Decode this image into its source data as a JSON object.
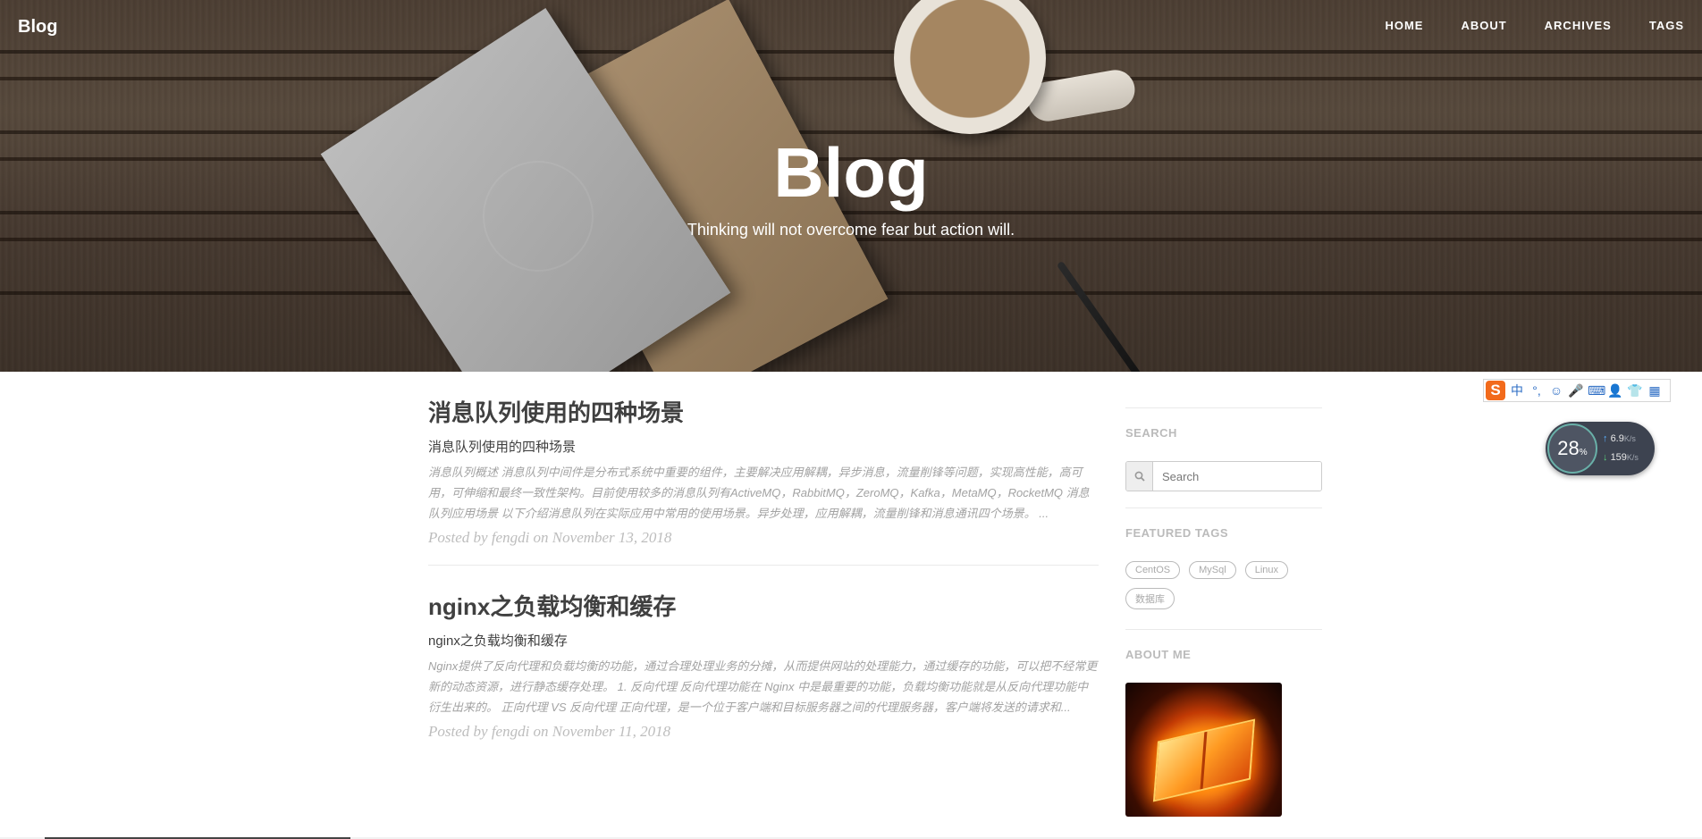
{
  "navbar": {
    "brand": "Blog",
    "links": [
      "HOME",
      "ABOUT",
      "ARCHIVES",
      "TAGS"
    ]
  },
  "hero": {
    "title": "Blog",
    "subtitle": "Thinking will not overcome fear but action will."
  },
  "posts": [
    {
      "title": "消息队列使用的四种场景",
      "subtitle": "消息队列使用的四种场景",
      "excerpt": "消息队列概述 消息队列中间件是分布式系统中重要的组件，主要解决应用解耦，异步消息，流量削锋等问题，实现高性能，高可用，可伸缩和最终一致性架构。目前使用较多的消息队列有ActiveMQ，RabbitMQ，ZeroMQ，Kafka，MetaMQ，RocketMQ 消息队列应用场景 以下介绍消息队列在实际应用中常用的使用场景。异步处理，应用解耦，流量削锋和消息通讯四个场景。 ...",
      "meta": "Posted by fengdi on November 13, 2018"
    },
    {
      "title": "nginx之负载均衡和缓存",
      "subtitle": "nginx之负载均衡和缓存",
      "excerpt": "Nginx提供了反向代理和负载均衡的功能，通过合理处理业务的分摊，从而提供网站的处理能力，通过缓存的功能，可以把不经常更新的动态资源，进行静态缓存处理。 1. 反向代理 反向代理功能在 Nginx 中是最重要的功能，负载均衡功能就是从反向代理功能中衍生出来的。 正向代理 VS 反向代理 正向代理，是一个位于客户端和目标服务器之间的代理服务器，客户端将发送的请求和...",
      "meta": "Posted by fengdi on November 11, 2018"
    }
  ],
  "sidebar": {
    "search_heading": "SEARCH",
    "search_placeholder": "Search",
    "tags_heading": "FEATURED TAGS",
    "tags": [
      "CentOS",
      "MySql",
      "Linux",
      "数据库"
    ],
    "about_heading": "ABOUT ME"
  },
  "ime_toolbar": {
    "logo": "S",
    "items": [
      "中",
      "°,",
      "☺",
      "🎤",
      "⌨",
      "👤",
      "👕",
      "▦"
    ]
  },
  "net_widget": {
    "percent": "28",
    "percent_unit": "%",
    "upload": "6.9",
    "download": "159",
    "unit": "K/s"
  }
}
